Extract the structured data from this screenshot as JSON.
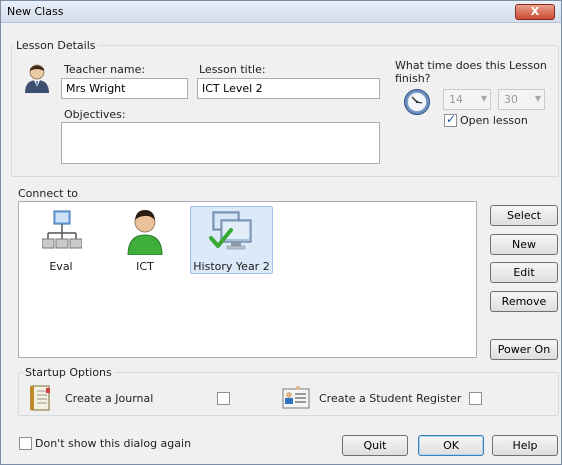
{
  "window": {
    "title": "New Class",
    "close_label": "X"
  },
  "lesson_details": {
    "group_label": "Lesson Details",
    "teacher_label": "Teacher name:",
    "teacher_value": "Mrs Wright",
    "lesson_title_label": "Lesson title:",
    "lesson_title_value": "ICT Level 2",
    "objectives_label": "Objectives:",
    "objectives_value": "",
    "finish_question": "What time does this Lesson finish?",
    "hour": "14",
    "minute": "30",
    "open_lesson_label": "Open lesson",
    "open_lesson_checked": true
  },
  "connect_to": {
    "group_label": "Connect to",
    "items": [
      {
        "label": "Eval",
        "icon": "network-icon",
        "selected": false
      },
      {
        "label": "ICT",
        "icon": "user-icon",
        "selected": false
      },
      {
        "label": "History Year 2",
        "icon": "computer-group-icon",
        "selected": true
      }
    ],
    "buttons": {
      "select": "Select",
      "new": "New",
      "edit": "Edit",
      "remove": "Remove",
      "power_on": "Power On"
    }
  },
  "startup_options": {
    "group_label": "Startup Options",
    "journal_label": "Create a Journal",
    "register_label": "Create a Student Register",
    "journal_checked": false,
    "register_checked": false
  },
  "footer": {
    "dont_show_label": "Don't show this dialog again",
    "quit": "Quit",
    "ok": "OK",
    "help": "Help"
  },
  "colors": {
    "selection": "#dce9f8",
    "accent": "#3c7fb1",
    "close": "#c84a32"
  }
}
